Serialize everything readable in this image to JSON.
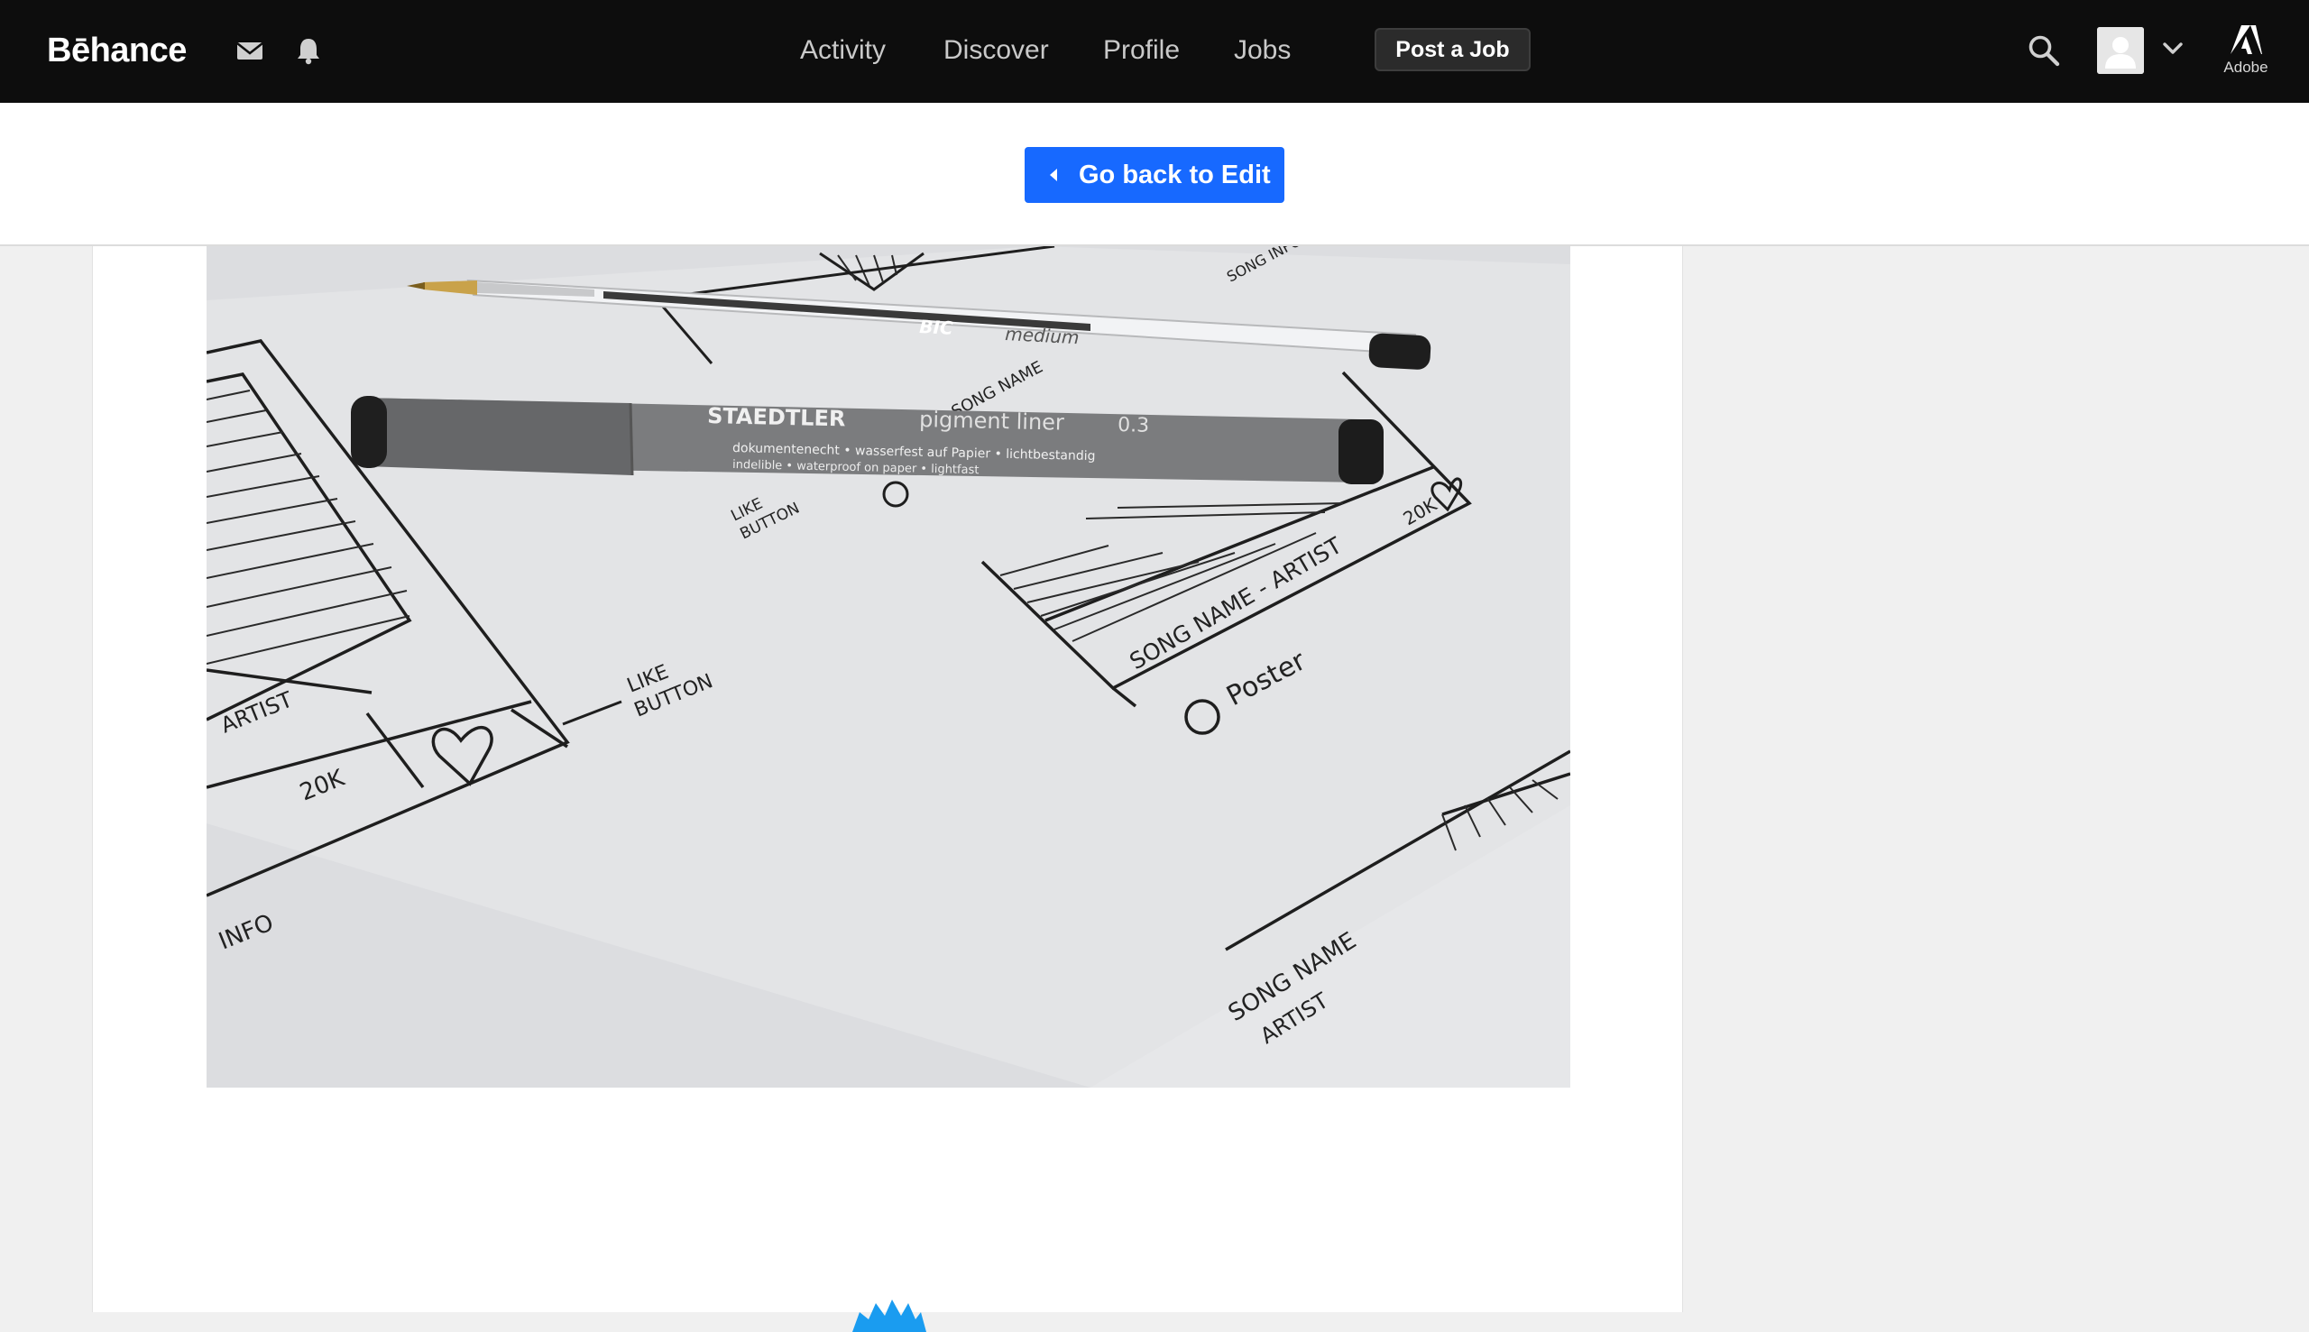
{
  "app": {
    "logo_text": "Bēhance",
    "brand_color": "#1769ff",
    "topbar_color": "#0d0d0d"
  },
  "header": {
    "icons": [
      "mail-icon",
      "bell-icon",
      "search-icon",
      "chevron-down-icon",
      "adobe-logo-icon"
    ],
    "nav": {
      "activity": "Activity",
      "discover": "Discover",
      "profile": "Profile",
      "jobs": "Jobs"
    },
    "post_job_label": "Post a Job",
    "adobe_label": "Adobe"
  },
  "edit_banner": {
    "back_label": "Go back to Edit",
    "icon": "caret-left-icon"
  },
  "project": {
    "image_description_icon": "sketch-photo",
    "sketch_text": {
      "pen_brand": "BIC",
      "pen_model": "medium",
      "marker_brand": "STAEDTLER",
      "marker_model": "pigment liner",
      "marker_size": "0.3",
      "marker_line1": "dokumentenecht • wasserfest auf Papier • lichtbestandig",
      "marker_line2": "indelible • waterproof on paper • lightfast",
      "like_button_small": "LIKE BUTTON",
      "like_button_large": "LIKE BUTTON",
      "artist_left": "ARTIST",
      "count_left": "20K",
      "info_left": "INFO",
      "song_name_top": "SONG NAME",
      "song_info_top": "SONG INFO",
      "song_name_artist": "SONG NAME - ARTIST",
      "count_right": "20K",
      "poster": "Poster",
      "song_name_bottom": "SONG NAME",
      "artist_bottom": "ARTIST"
    }
  }
}
